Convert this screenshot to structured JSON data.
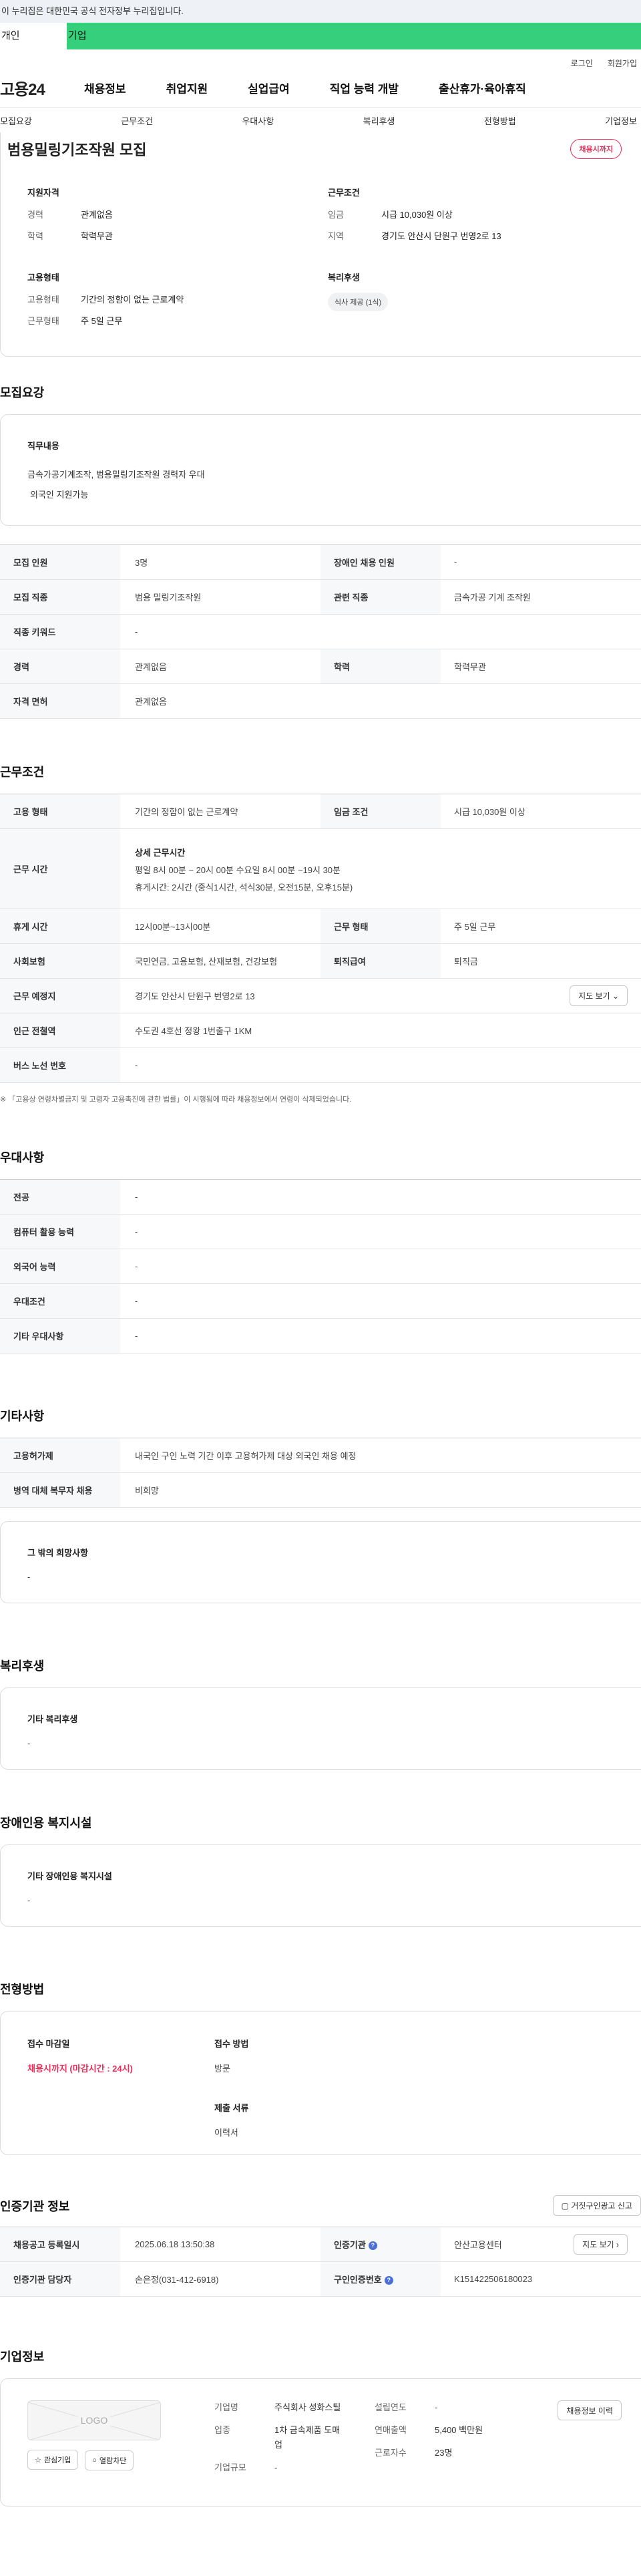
{
  "gov_notice": "이 누리집은 대한민국 공식 전자정부 누리집입니다.",
  "top_tabs": [
    "개인",
    "기업"
  ],
  "util_links": [
    "로그인",
    "회원가입"
  ],
  "logo_text": "고용24",
  "gnb_menu": [
    "채용정보",
    "취업지원",
    "실업급여",
    "직업 능력 개발",
    "출산휴가·육아휴직"
  ],
  "snb_menu": [
    "모집요강",
    "근무조건",
    "우대사항",
    "복리후생",
    "전형방법",
    "기업정보"
  ],
  "summary": {
    "title": "범용밀링기조작원 모집",
    "deadline_badge": "채용시까지",
    "qual": {
      "heading": "지원자격",
      "rows": [
        {
          "k": "경력",
          "v": "관계없음"
        },
        {
          "k": "학력",
          "v": "학력무관"
        }
      ]
    },
    "cond": {
      "heading": "근무조건",
      "rows": [
        {
          "k": "임금",
          "v": "시급 10,030원 이상"
        },
        {
          "k": "지역",
          "v": "경기도 안산시 단원구 번영2로 13"
        }
      ]
    },
    "emp": {
      "heading": "고용형태",
      "rows": [
        {
          "k": "고용형태",
          "v": "기간의 정함이 없는 근로계약"
        },
        {
          "k": "근무형태",
          "v": "주 5일 근무"
        }
      ]
    },
    "welfare": {
      "heading": "복리후생",
      "chip": "식사 제공 (1식)"
    }
  },
  "recruit": {
    "title": "모집요강",
    "duty_heading": "직무내용",
    "duty_lines": [
      "금속가공기계조작, 범용밀링기조작원   경력자 우대",
      "외국인 지원가능"
    ],
    "table": [
      [
        "모집 인원",
        "3명",
        "장애인 채용 인원",
        "-"
      ],
      [
        "모집 직종",
        "범용 밀링기조작원",
        "관련 직종",
        "금속가공 기계 조작원"
      ],
      [
        "직종 키워드",
        "-",
        "",
        ""
      ],
      [
        "경력",
        "관계없음",
        "학력",
        "학력무관"
      ],
      [
        "자격 면허",
        "관계없음",
        "",
        ""
      ]
    ]
  },
  "work": {
    "title": "근무조건",
    "r1": [
      "고용 형태",
      "기간의 정함이 없는 근로계약",
      "임금 조건",
      "시급 10,030원 이상"
    ],
    "time_label": "근무 시간",
    "time_heading": "상세 근무시간",
    "time_line1": "평일  8시 00분 ~ 20시 00분   수요일 8시 00분 ~19시 30분",
    "time_line2": "휴게시간: 2시간 (중식1시간, 석식30분, 오전15분, 오후15분)",
    "r3": [
      "휴게 시간",
      "12시00분~13시00분",
      "근무 형태",
      "주 5일 근무"
    ],
    "r4": [
      "사회보험",
      "국민연금, 고용보험, 산재보험, 건강보험",
      "퇴직급여",
      "퇴직금"
    ],
    "place_label": "근무 예정지",
    "place_value": "경기도 안산시 단원구 번영2로 13",
    "map_btn": "지도 보기",
    "r6": [
      "인근 전철역",
      "수도권 4호선 정왕 1번출구 1KM"
    ],
    "r7": [
      "버스 노선 번호",
      "-"
    ],
    "note": "※ 「고용상 연령차별금지 및 고령자 고용촉진에 관한 법률」이 시행됨에 따라 채용정보에서 연령이 삭제되었습니다."
  },
  "pref": {
    "title": "우대사항",
    "rows": [
      [
        "전공",
        "-"
      ],
      [
        "컴퓨터 활용 능력",
        "-"
      ],
      [
        "외국어 능력",
        "-"
      ],
      [
        "우대조건",
        "-"
      ],
      [
        "기타 우대사항",
        "-"
      ]
    ]
  },
  "etc": {
    "title": "기타사항",
    "rows": [
      [
        "고용허가제",
        "내국인 구인 노력 기간 이후 고용허가제 대상 외국인 채용 예정"
      ],
      [
        "병역 대체 복무자 채용",
        "비희망"
      ]
    ],
    "other_heading": "그 밖의 희망사항",
    "other_value": "-"
  },
  "benefit": {
    "title": "복리후생",
    "heading": "기타 복리후생",
    "value": "-"
  },
  "disabled": {
    "title": "장애인용 복지시설",
    "heading": "기타 장애인용 복지시설",
    "value": "-"
  },
  "selection": {
    "title": "전형방법",
    "deadline_heading": "접수 마감일",
    "deadline_value": "채용시까지 (마감시간 : 24시)",
    "method_heading": "접수 방법",
    "method_value": "방문",
    "docs_heading": "제출 서류",
    "docs_value": "이력서"
  },
  "agency": {
    "title": "인증기관 정보",
    "report_btn": "거짓구인광고 신고",
    "r1": [
      "채용공고 등록일시",
      "2025.06.18 13:50:38",
      "인증기관",
      "안산고용센터"
    ],
    "r2": [
      "인증기관 담당자",
      "손은정(031-412-6918)",
      "구인인증번호",
      "K151422506180023"
    ],
    "map_btn": "지도 보기"
  },
  "company": {
    "title": "기업정보",
    "logo_text": "LOGO",
    "fav_btn": "관심기업",
    "block_btn": "열람차단",
    "name_k": "기업명",
    "name_v": "주식회사 성화스틸",
    "biz_k": "업종",
    "biz_v": "1차 금속제품 도매업",
    "size_k": "기업규모",
    "size_v": "-",
    "est_k": "설립연도",
    "est_v": "-",
    "sales_k": "연매출액",
    "sales_v": "5,400 백만원",
    "emp_k": "근로자수",
    "emp_v": "23명",
    "history_btn": "채용정보 이력"
  }
}
